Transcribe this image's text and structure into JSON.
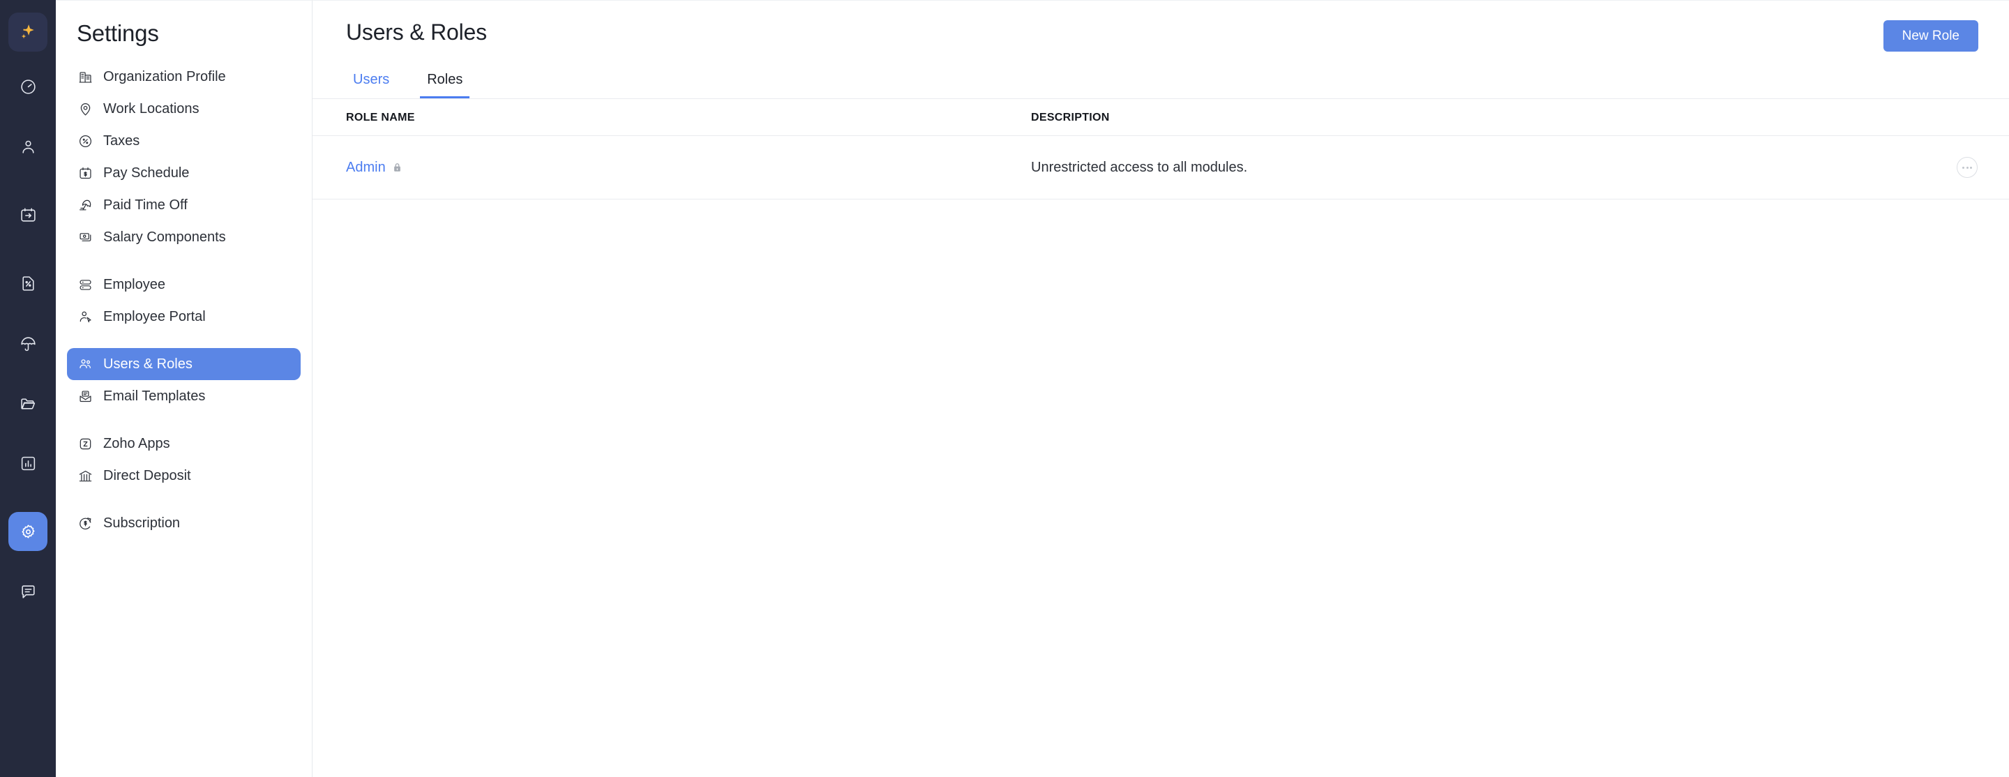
{
  "rail": {
    "items": [
      {
        "name": "ai-sparkle-icon",
        "label": "AI Assistant",
        "active": false,
        "logo": true
      },
      {
        "name": "dashboard-gauge-icon",
        "label": "Dashboard",
        "active": false
      },
      {
        "name": "person-icon",
        "label": "Employees",
        "active": false
      },
      {
        "name": "calendar-arrow-icon",
        "label": "Pay Runs",
        "active": false
      },
      {
        "name": "percent-document-icon",
        "label": "Taxes & Forms",
        "active": false
      },
      {
        "name": "umbrella-icon",
        "label": "Benefits",
        "active": false
      },
      {
        "name": "folder-icon",
        "label": "Documents",
        "active": false
      },
      {
        "name": "bar-chart-icon",
        "label": "Reports",
        "active": false
      },
      {
        "name": "gear-icon",
        "label": "Settings",
        "active": true
      },
      {
        "name": "chat-bubble-icon",
        "label": "Chat",
        "active": false
      }
    ]
  },
  "sidebar": {
    "title": "Settings",
    "groups": [
      {
        "items": [
          {
            "icon": "organization-icon",
            "label": "Organization Profile",
            "active": false
          },
          {
            "icon": "location-pin-icon",
            "label": "Work Locations",
            "active": false
          },
          {
            "icon": "percent-circle-icon",
            "label": "Taxes",
            "active": false
          },
          {
            "icon": "calendar-dollar-icon",
            "label": "Pay Schedule",
            "active": false
          },
          {
            "icon": "beach-umbrella-icon",
            "label": "Paid Time Off",
            "active": false
          },
          {
            "icon": "money-stack-icon",
            "label": "Salary Components",
            "active": false
          }
        ]
      },
      {
        "items": [
          {
            "icon": "server-icon",
            "label": "Employee",
            "active": false
          },
          {
            "icon": "person-cursor-icon",
            "label": "Employee Portal",
            "active": false
          }
        ]
      },
      {
        "items": [
          {
            "icon": "users-icon",
            "label": "Users & Roles",
            "active": true
          },
          {
            "icon": "email-icon",
            "label": "Email Templates",
            "active": false
          }
        ]
      },
      {
        "items": [
          {
            "icon": "zoho-icon",
            "label": "Zoho Apps",
            "active": false
          },
          {
            "icon": "bank-icon",
            "label": "Direct Deposit",
            "active": false
          }
        ]
      },
      {
        "items": [
          {
            "icon": "refresh-dollar-icon",
            "label": "Subscription",
            "active": false
          }
        ]
      }
    ]
  },
  "header": {
    "title": "Users & Roles",
    "new_role_label": "New Role"
  },
  "tabs": [
    {
      "label": "Users",
      "active": false
    },
    {
      "label": "Roles",
      "active": true
    }
  ],
  "table": {
    "columns": [
      "ROLE NAME",
      "DESCRIPTION"
    ],
    "rows": [
      {
        "role_name": "Admin",
        "locked": true,
        "description": "Unrestricted access to all modules.",
        "more_label": "More actions"
      }
    ]
  },
  "colors": {
    "accent": "#5b86e5",
    "link": "#4c7df0",
    "rail_bg": "#252a3d",
    "rail_logo_bg": "#2e3450",
    "border": "#e9ebef",
    "text": "#2c3038",
    "sparkle": "#f5b63f"
  }
}
